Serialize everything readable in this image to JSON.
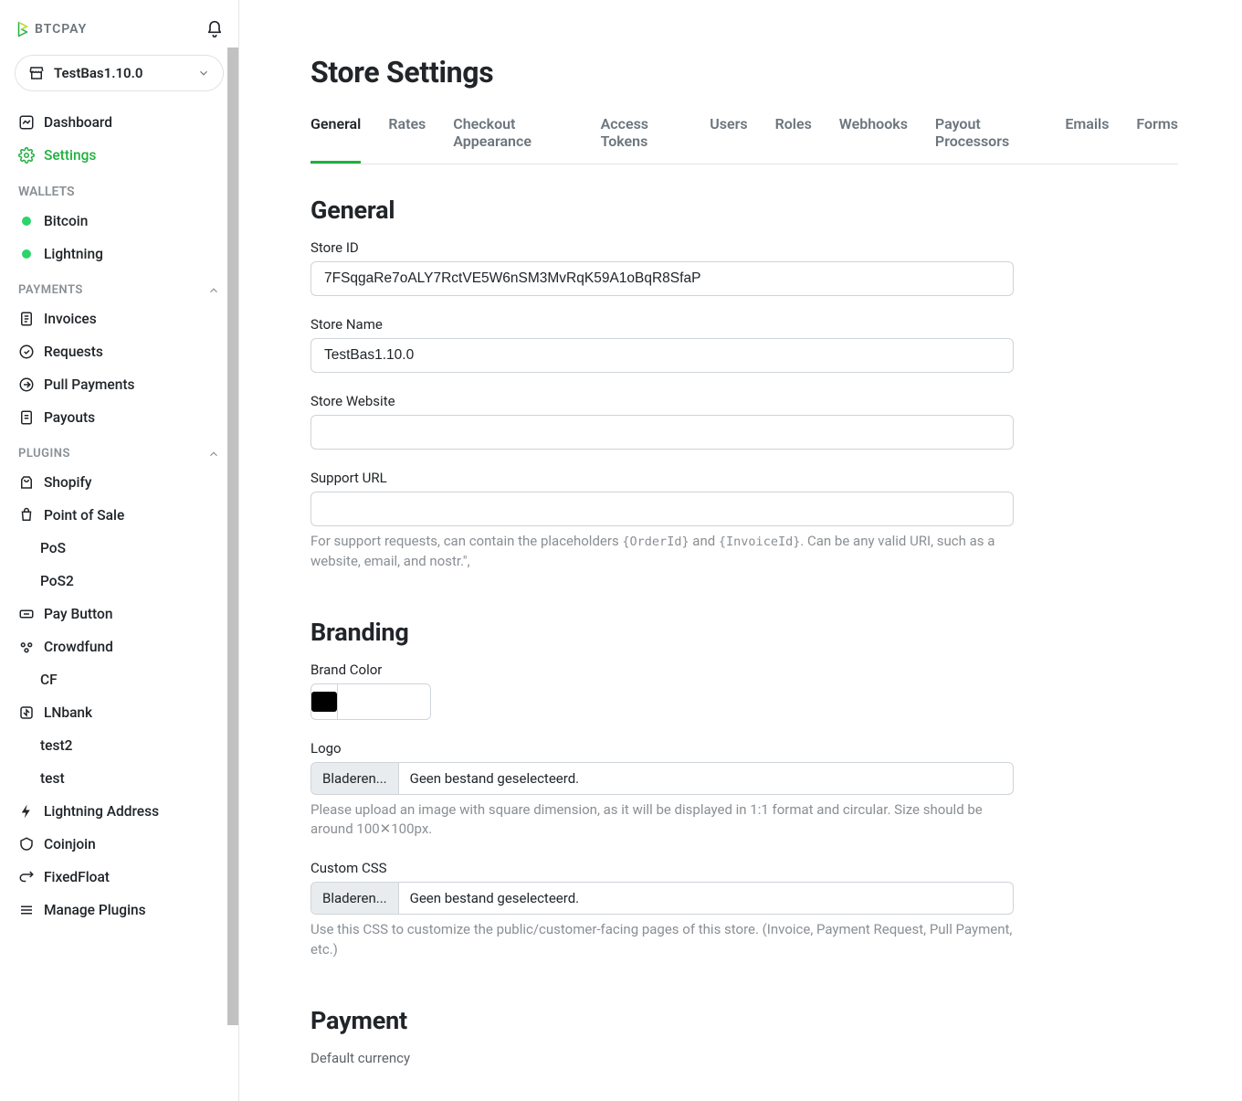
{
  "brand": {
    "name": "BTCPAY"
  },
  "store_selector": {
    "name": "TestBas1.10.0"
  },
  "nav": {
    "dashboard": "Dashboard",
    "settings": "Settings"
  },
  "wallets_header": "WALLETS",
  "wallets": {
    "bitcoin": "Bitcoin",
    "lightning": "Lightning"
  },
  "payments_header": "PAYMENTS",
  "payments": {
    "invoices": "Invoices",
    "requests": "Requests",
    "pull_payments": "Pull Payments",
    "payouts": "Payouts"
  },
  "plugins_header": "PLUGINS",
  "plugins": {
    "shopify": "Shopify",
    "pos": "Point of Sale",
    "pos_children": [
      "PoS",
      "PoS2"
    ],
    "pay_button": "Pay Button",
    "crowdfund": "Crowdfund",
    "crowdfund_children": [
      "CF"
    ],
    "lnbank": "LNbank",
    "lnbank_children": [
      "test2",
      "test"
    ],
    "lightning_address": "Lightning Address",
    "coinjoin": "Coinjoin",
    "fixedfloat": "FixedFloat",
    "manage_plugins": "Manage Plugins"
  },
  "page": {
    "title": "Store Settings",
    "tabs": [
      "General",
      "Rates",
      "Checkout Appearance",
      "Access Tokens",
      "Users",
      "Roles",
      "Webhooks",
      "Payout Processors",
      "Emails",
      "Forms"
    ],
    "sections": {
      "general": "General",
      "branding": "Branding",
      "payment": "Payment"
    },
    "labels": {
      "store_id": "Store ID",
      "store_name": "Store Name",
      "store_website": "Store Website",
      "support_url": "Support URL",
      "brand_color": "Brand Color",
      "logo": "Logo",
      "custom_css": "Custom CSS",
      "default_currency": "Default currency"
    },
    "values": {
      "store_id": "7FSqgaRe7oALY7RctVE5W6nSM3MvRqK59A1oBqR8SfaP",
      "store_name": "TestBas1.10.0",
      "store_website": "",
      "support_url": "",
      "brand_color_hex": "#000000",
      "brand_color_text": ""
    },
    "file_input": {
      "button": "Bladeren...",
      "no_file": "Geen bestand geselecteerd."
    },
    "help": {
      "support_url_pre": "For support requests, can contain the placeholders ",
      "support_url_mid": " and ",
      "support_url_post": ". Can be any valid URI, such as a website, email, and nostr.\",",
      "code_order": "{OrderId}",
      "code_invoice": "{InvoiceId}",
      "logo": "Please upload an image with square dimension, as it will be displayed in 1:1 format and circular. Size should be around 100✕100px.",
      "css": "Use this CSS to customize the public/customer-facing pages of this store. (Invoice, Payment Request, Pull Payment, etc.)"
    }
  }
}
